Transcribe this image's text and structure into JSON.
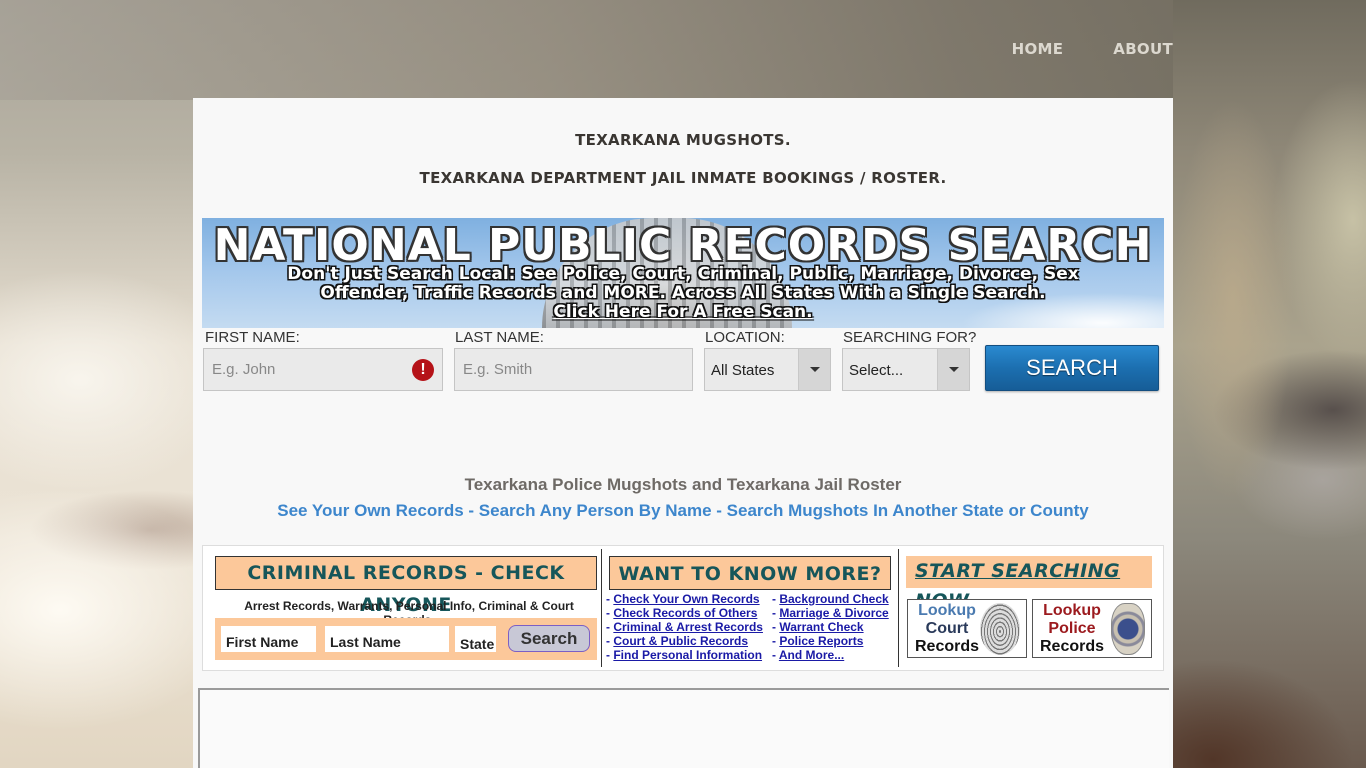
{
  "nav": {
    "items": [
      {
        "label": "HOME"
      },
      {
        "label": "ABOUT"
      }
    ]
  },
  "page": {
    "heading_1": "TEXARKANA MUGSHOTS.",
    "heading_2": "TEXARKANA DEPARTMENT JAIL INMATE BOOKINGS / ROSTER."
  },
  "banner": {
    "title": "NATIONAL PUBLIC RECORDS SEARCH",
    "line_1": "Don't Just Search Local: See Police, Court, Criminal, Public, Marriage, Divorce, Sex",
    "line_2": "Offender, Traffic Records and MORE. Across All States With a Single Search.",
    "cta": "Click Here For A Free Scan."
  },
  "search_form": {
    "first_name_label": "FIRST NAME:",
    "first_name_placeholder": "E.g. John",
    "first_name_value": "",
    "first_name_alert_icon": "exclamation-icon",
    "last_name_label": "LAST NAME:",
    "last_name_placeholder": "E.g. Smith",
    "last_name_value": "",
    "location_label": "LOCATION:",
    "location_value": "All States",
    "searching_for_label": "SEARCHING FOR?",
    "searching_for_value": "Select...",
    "search_button": "SEARCH"
  },
  "content": {
    "subtitle": "Texarkana Police Mugshots and Texarkana Jail Roster",
    "links": [
      {
        "label": "See Your Own Records"
      },
      {
        "label": "Search Any Person By Name"
      },
      {
        "label": "Search Mugshots In Another State or County"
      }
    ],
    "separator": " - "
  },
  "ad": {
    "criminal": {
      "title": "CRIMINAL RECORDS - CHECK ANYONE",
      "description": "Arrest Records, Warrants, Personal Info, Criminal & Court Records.",
      "first_name": "First Name",
      "last_name": "Last Name",
      "state": "State",
      "search_button": "Search"
    },
    "more": {
      "title": "WANT TO KNOW MORE?",
      "left_links": [
        "Check Your Own Records",
        "Check Records of Others",
        "Criminal & Arrest Records",
        "Court & Public Records",
        "Find Personal Information"
      ],
      "right_links": [
        "Background Check",
        "Marriage & Divorce",
        "Warrant Check",
        "Police Reports",
        "And More..."
      ],
      "bullet": "-"
    },
    "start": {
      "title": "START SEARCHING NOW",
      "court_card": {
        "line_1": "Lookup",
        "line_2": "Court",
        "line_3": "Records",
        "line_1_color": "#4a7ab0",
        "line_2_color": "#2a3a5a",
        "line_3_color": "#111111"
      },
      "police_card": {
        "line_1": "Lookup",
        "line_2": "Police",
        "line_3": "Records",
        "line_1_color": "#9c1a1e",
        "line_2_color": "#9c1a1e",
        "line_3_color": "#111111"
      }
    }
  },
  "colors": {
    "accent_blue": "#3d86cc",
    "search_button": "#1c6fb0",
    "ad_header_bg": "#fcc89a",
    "ad_header_text": "#16565a",
    "link_blue": "#1a1aa6",
    "alert_red": "#b51218"
  }
}
